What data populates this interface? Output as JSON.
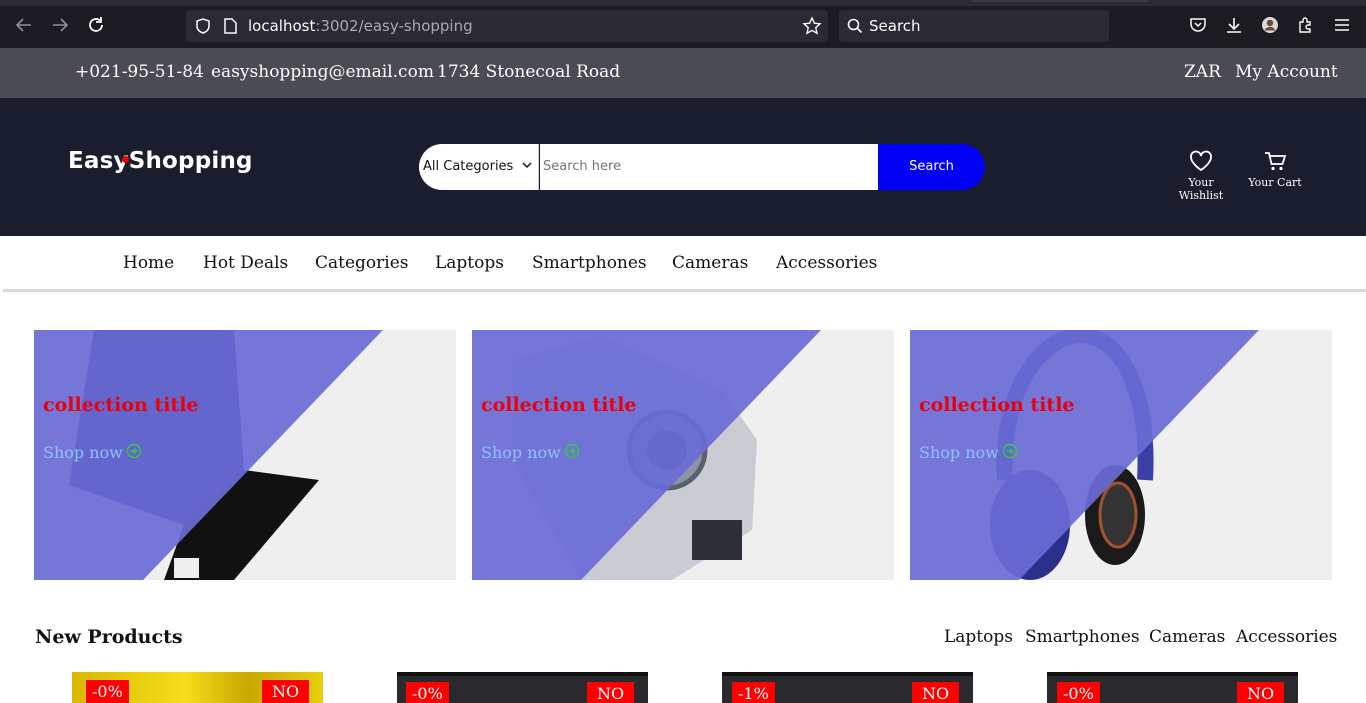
{
  "browser": {
    "url_host": "localhost",
    "url_path": ":3002/easy-shopping",
    "search_label": "Search",
    "icons": [
      "back-icon",
      "forward-icon",
      "reload-icon",
      "shield-icon",
      "page-icon",
      "star-icon",
      "search-icon",
      "pocket-icon",
      "download-icon",
      "account-icon",
      "extensions-icon",
      "menu-icon"
    ]
  },
  "topbar": {
    "phone": "+021-95-51-84",
    "email": "easyshopping@email.com",
    "address": "1734 Stonecoal Road",
    "currency": "ZAR",
    "account": "My Account"
  },
  "header": {
    "logo": "EasyShopping",
    "category_select": "All Categories",
    "search_placeholder": "Search here",
    "search_button": "Search",
    "wishlist_label": "Your Wishlist",
    "cart_label": "Your Cart",
    "colors": {
      "background": "#1a1d2e",
      "search_button": "#0000f5",
      "logo_accent": "#e00000"
    }
  },
  "nav": {
    "items": [
      "Home",
      "Hot Deals",
      "Categories",
      "Laptops",
      "Smartphones",
      "Cameras",
      "Accessories"
    ]
  },
  "collections": [
    {
      "title": "collection title",
      "cta": "Shop now",
      "image": "laptop"
    },
    {
      "title": "collection title",
      "cta": "Shop now",
      "image": "camera"
    },
    {
      "title": "collection title",
      "cta": "Shop now",
      "image": "headphones"
    }
  ],
  "new_products": {
    "title": "New Products",
    "tabs": [
      "Laptops",
      "Smartphones",
      "Cameras",
      "Accessories"
    ],
    "products": [
      {
        "discount": "-0%",
        "tag": "NO"
      },
      {
        "discount": "-0%",
        "tag": "NO"
      },
      {
        "discount": "-1%",
        "tag": "NO"
      },
      {
        "discount": "-0%",
        "tag": "NO"
      }
    ]
  },
  "colors": {
    "overlay": "#6a6bd6",
    "collection_title": "#e8000b",
    "shop_now": "#8ec3ff",
    "badge": "#ff0000"
  }
}
